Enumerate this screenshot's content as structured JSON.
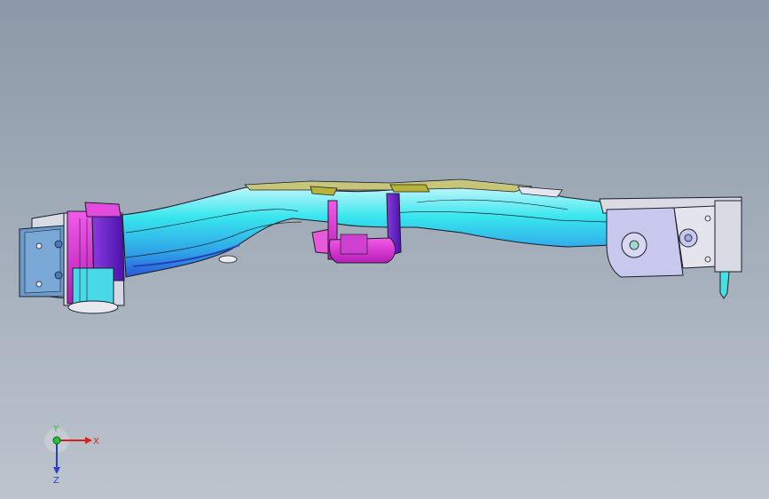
{
  "viewport": {
    "background_top": "#8c99a8",
    "background_bottom": "#bcc4cd"
  },
  "model": {
    "name_icon": "crossmember-assembly-3d-model",
    "colors": {
      "outline": "#1a1f2a",
      "beam_cyan": "#38e6ee",
      "beam_blue": "#2a6be0",
      "beam_light": "#bff4f8",
      "purple": "#6a1ec8",
      "magenta": "#e02ad8",
      "olive": "#b6b23a",
      "lavender": "#c8c8ee",
      "steel": "#6c9acb",
      "grey": "#e2e3ea"
    }
  },
  "triad": {
    "x_label": "X",
    "y_label": "Y",
    "z_label": "Z",
    "x_color": "#d52020",
    "y_color": "#23c23a",
    "z_color": "#2a3fd0"
  }
}
